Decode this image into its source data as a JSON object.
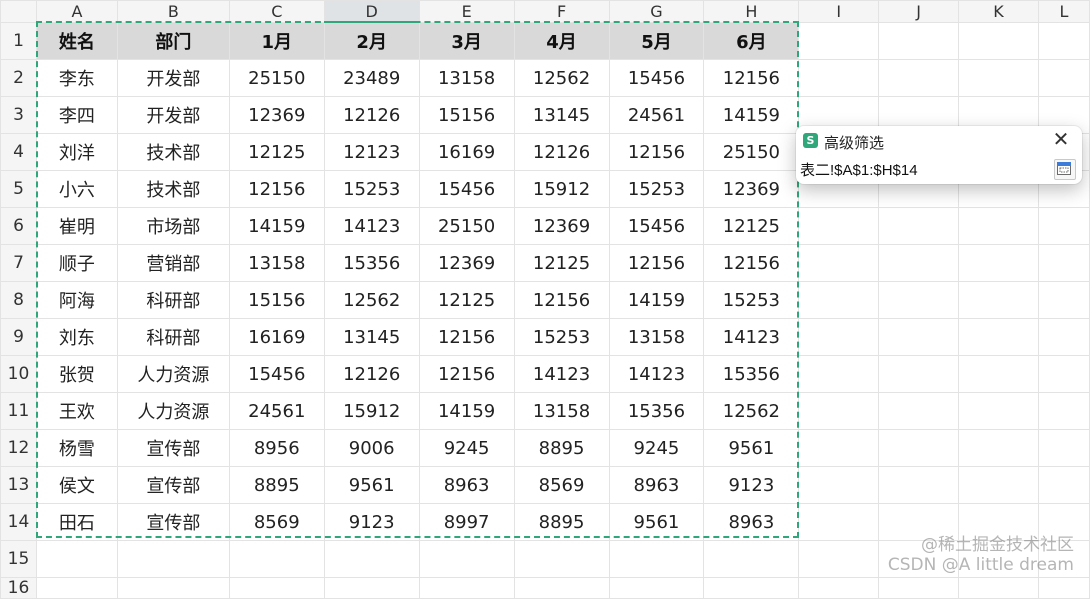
{
  "columns": [
    "A",
    "B",
    "C",
    "D",
    "E",
    "F",
    "G",
    "H",
    "I",
    "J",
    "K",
    "L"
  ],
  "active_column": "D",
  "headers": [
    "姓名",
    "部门",
    "1月",
    "2月",
    "3月",
    "4月",
    "5月",
    "6月"
  ],
  "rows": [
    [
      "李东",
      "开发部",
      "25150",
      "23489",
      "13158",
      "12562",
      "15456",
      "12156"
    ],
    [
      "李四",
      "开发部",
      "12369",
      "12126",
      "15156",
      "13145",
      "24561",
      "14159"
    ],
    [
      "刘洋",
      "技术部",
      "12125",
      "12123",
      "16169",
      "12126",
      "12156",
      "25150"
    ],
    [
      "小六",
      "技术部",
      "12156",
      "15253",
      "15456",
      "15912",
      "15253",
      "12369"
    ],
    [
      "崔明",
      "市场部",
      "14159",
      "14123",
      "25150",
      "12369",
      "15456",
      "12125"
    ],
    [
      "顺子",
      "营销部",
      "13158",
      "15356",
      "12369",
      "12125",
      "12156",
      "12156"
    ],
    [
      "阿海",
      "科研部",
      "15156",
      "12562",
      "12125",
      "12156",
      "14159",
      "15253"
    ],
    [
      "刘东",
      "科研部",
      "16169",
      "13145",
      "12156",
      "15253",
      "13158",
      "14123"
    ],
    [
      "张贺",
      "人力资源",
      "15456",
      "12126",
      "12156",
      "14123",
      "14123",
      "15356"
    ],
    [
      "王欢",
      "人力资源",
      "24561",
      "15912",
      "14159",
      "13158",
      "15356",
      "12562"
    ],
    [
      "杨雪",
      "宣传部",
      "8956",
      "9006",
      "9245",
      "8895",
      "9245",
      "9561"
    ],
    [
      "侯文",
      "宣传部",
      "8895",
      "9561",
      "8963",
      "8569",
      "8963",
      "9123"
    ],
    [
      "田石",
      "宣传部",
      "8569",
      "9123",
      "8997",
      "8895",
      "9561",
      "8963"
    ]
  ],
  "row_numbers": [
    "1",
    "2",
    "3",
    "4",
    "5",
    "6",
    "7",
    "8",
    "9",
    "10",
    "11",
    "12",
    "13",
    "14",
    "15",
    "16"
  ],
  "dialog": {
    "title": "高级筛选",
    "app_icon_glyph": "S",
    "close_glyph": "✕",
    "range_value": "表二!$A$1:$H$14"
  },
  "watermark": {
    "line1": "@稀土掘金技术社区",
    "line2": "CSDN @A little dream"
  },
  "colors": {
    "selection": "#2fa77a",
    "header_fill": "#d9d9d9"
  }
}
